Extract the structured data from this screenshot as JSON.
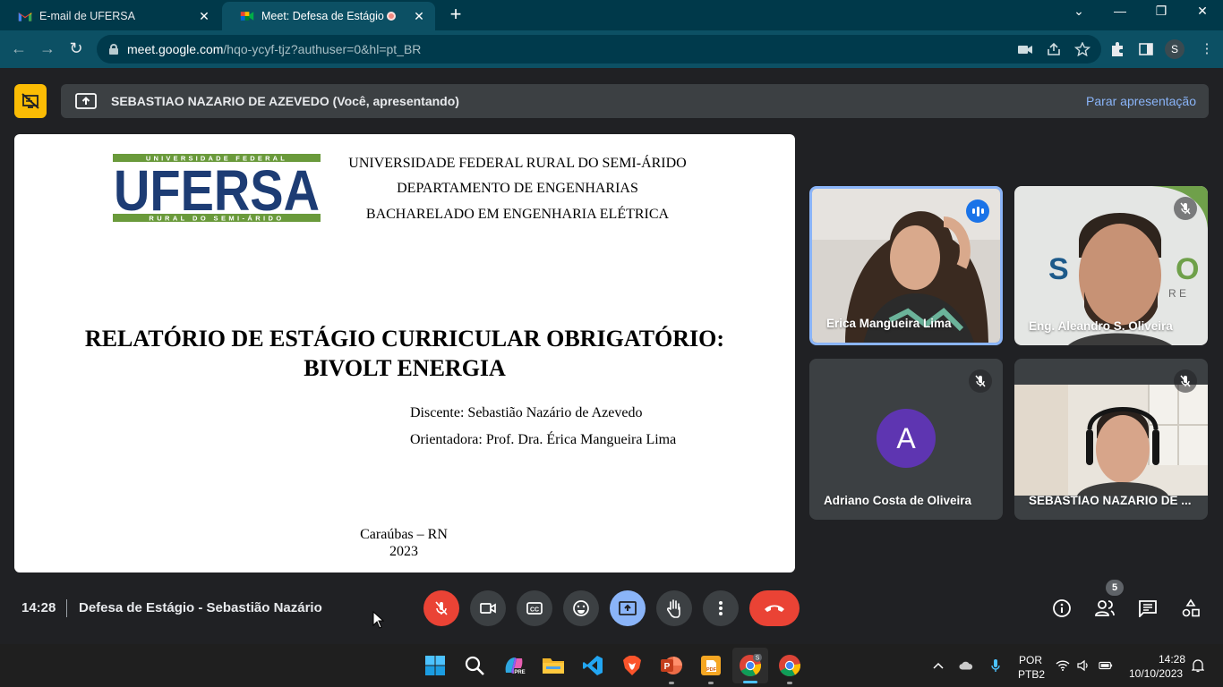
{
  "browser": {
    "tabs": [
      {
        "title": "E-mail de UFERSA",
        "icon": "gmail-icon",
        "active": false
      },
      {
        "title": "Meet: Defesa de Estágio - Se",
        "icon": "meet-icon",
        "active": true
      }
    ],
    "url_host": "meet.google.com",
    "url_path": "/hqo-ycyf-tjz?authuser=0&hl=pt_BR",
    "profile_initial": "S"
  },
  "meet": {
    "presenting_text": "SEBASTIAO NAZARIO DE AZEVEDO (Você, apresentando)",
    "stop_presenting": "Parar apresentação",
    "slide": {
      "institution": [
        "UNIVERSIDADE FEDERAL RURAL DO SEMI-ÁRIDO",
        "DEPARTAMENTO DE ENGENHARIAS",
        "BACHARELADO EM ENGENHARIA ELÉTRICA"
      ],
      "logo": {
        "top": "UNIVERSIDADE FEDERAL",
        "main": "UFERSA",
        "bottom": "RURAL DO SEMI-ÁRIDO",
        "green": "#6a9a3b",
        "blue": "#1d3c74"
      },
      "title_line1": "RELATÓRIO DE ESTÁGIO CURRICULAR OBRIGATÓRIO:",
      "title_line2": "BIVOLT ENERGIA",
      "student": "Discente: Sebastião Nazário de Azevedo",
      "advisor": "Orientadora: Prof. Dra. Érica Mangueira Lima",
      "city": "Caraúbas – RN",
      "year": "2023"
    },
    "participants": [
      {
        "name": "Erica Mangueira Lima",
        "speaking": true
      },
      {
        "name": "Eng. Aleandro S. Oliveira",
        "muted": true
      },
      {
        "name": "Adriano Costa de Oliveira",
        "muted": true,
        "avatar_letter": "A"
      },
      {
        "name": "SEBASTIAO NAZARIO DE ...",
        "muted": true
      }
    ],
    "time": "14:28",
    "meeting_title": "Defesa de Estágio - Sebastião Nazário",
    "participant_count": "5"
  },
  "taskbar": {
    "lang_top": "POR",
    "lang_bottom": "PTB2",
    "time": "14:28",
    "date": "10/10/2023"
  }
}
